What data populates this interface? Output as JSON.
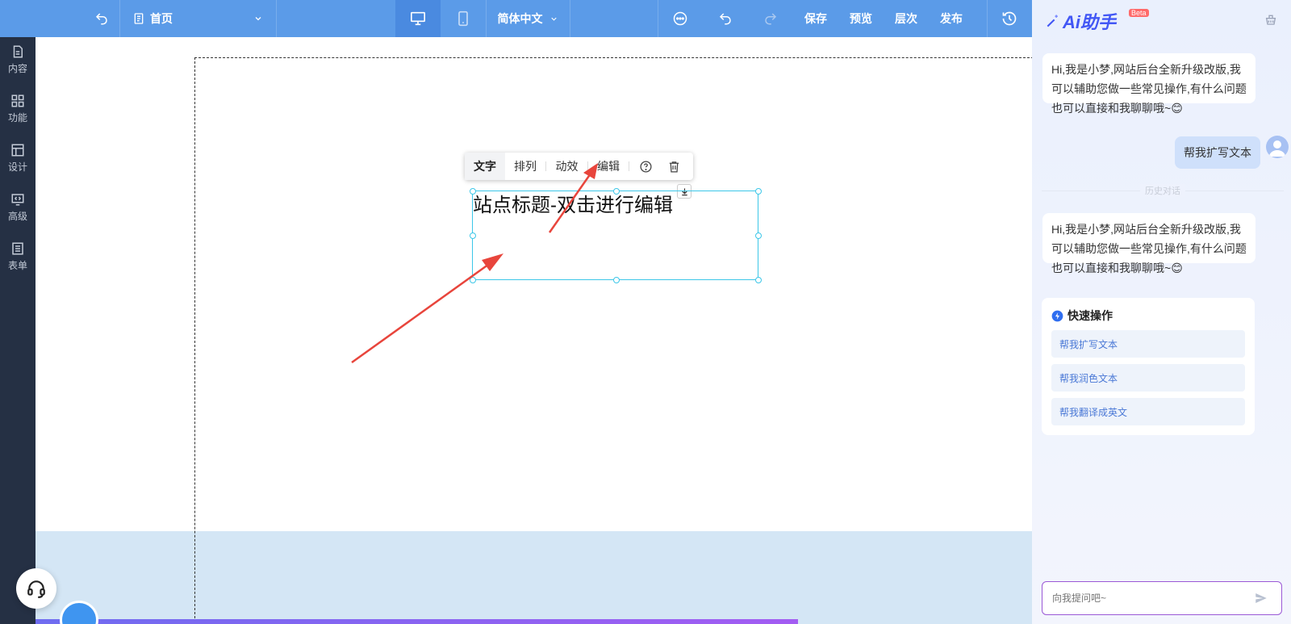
{
  "topbar": {
    "page_select_label": "首页",
    "language_label": "简体中文",
    "save_label": "保存",
    "preview_label": "预览",
    "layers_label": "层次",
    "publish_label": "发布"
  },
  "sidebar": {
    "items": [
      {
        "label": "内容",
        "icon": "document-icon"
      },
      {
        "label": "功能",
        "icon": "grid-icon"
      },
      {
        "label": "设计",
        "icon": "layout-icon"
      },
      {
        "label": "高级",
        "icon": "code-icon"
      },
      {
        "label": "表单",
        "icon": "form-icon"
      }
    ]
  },
  "editor": {
    "toolbar_tabs": [
      "文字",
      "排列",
      "动效",
      "编辑"
    ],
    "text_element": "站点标题-双击进行编辑"
  },
  "ai": {
    "title": "Ai助手",
    "beta": "Beta",
    "greeting": "Hi,我是小梦,网站后台全新升级改版,我可以辅助您做一些常见操作,有什么问题也可以直接和我聊聊哦~",
    "user_message": "帮我扩写文本",
    "history_label": "历史对话",
    "greeting2": "Hi,我是小梦,网站后台全新升级改版,我可以辅助您做一些常见操作,有什么问题也可以直接和我聊聊哦~",
    "quick_title": "快速操作",
    "quick_actions": [
      "帮我扩写文本",
      "帮我润色文本",
      "帮我翻译成英文"
    ],
    "input_placeholder": "向我提问吧~"
  },
  "colors": {
    "topbar": "#5b9be8",
    "sidebar": "#253044",
    "selection": "#3cc7e8",
    "arrow": "#e8453c",
    "ai_accent": "#4257f5"
  }
}
